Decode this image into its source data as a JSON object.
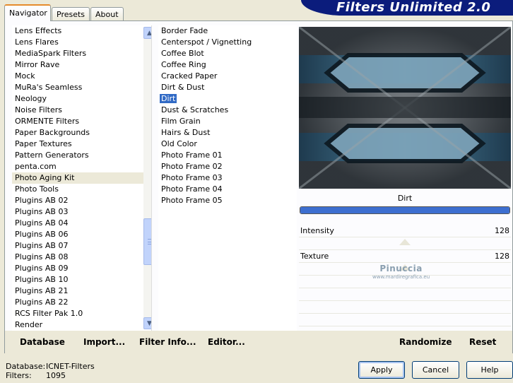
{
  "app": {
    "title": "Filters Unlimited 2.0"
  },
  "tabs": [
    {
      "label": "Navigator",
      "active": true
    },
    {
      "label": "Presets",
      "active": false
    },
    {
      "label": "About",
      "active": false
    }
  ],
  "categories": [
    "Lens Effects",
    "Lens Flares",
    "MediaSpark Filters",
    "Mirror Rave",
    "Mock",
    "MuRa's Seamless",
    "Neology",
    "Noise Filters",
    "ORMENTE Filters",
    "Paper Backgrounds",
    "Paper Textures",
    "Pattern Generators",
    "penta.com",
    "Photo Aging Kit",
    "Photo Tools",
    "Plugins AB 02",
    "Plugins AB 03",
    "Plugins AB 04",
    "Plugins AB 06",
    "Plugins AB 07",
    "Plugins AB 08",
    "Plugins AB 09",
    "Plugins AB 10",
    "Plugins AB 21",
    "Plugins AB 22",
    "RCS Filter Pak 1.0",
    "Render"
  ],
  "highlighted_category": "Photo Aging Kit",
  "filters": [
    "Border Fade",
    "Centerspot / Vignetting",
    "Coffee Blot",
    "Coffee Ring",
    "Cracked Paper",
    "Dirt & Dust",
    "Dirt",
    "Dust & Scratches",
    "Film Grain",
    "Hairs & Dust",
    "Old Color",
    "Photo Frame 01",
    "Photo Frame 02",
    "Photo Frame 03",
    "Photo Frame 04",
    "Photo Frame 05"
  ],
  "selected_filter": "Dirt",
  "preview": {
    "filter_name": "Dirt",
    "progress": 1.0
  },
  "parameters": [
    {
      "label": "Intensity",
      "value": "128",
      "level": 0.5
    },
    {
      "label": "Texture",
      "value": "128",
      "level": 0.5
    }
  ],
  "watermark": {
    "line1": "Pinuccia",
    "line2": "www.mardiregrafica.eu"
  },
  "panel_buttons": {
    "database": "Database",
    "import": "Import...",
    "filter_info": "Filter Info...",
    "editor": "Editor...",
    "randomize": "Randomize",
    "reset": "Reset"
  },
  "status": {
    "database_label": "Database:",
    "database_value": "ICNET-Filters",
    "filters_label": "Filters:",
    "filters_value": "1095"
  },
  "dialog_buttons": {
    "apply": "Apply",
    "cancel": "Cancel",
    "help": "Help"
  },
  "colors": {
    "banner": "#0b1c7c",
    "selection": "#316ac5",
    "accent_tab": "#e68b2c"
  }
}
